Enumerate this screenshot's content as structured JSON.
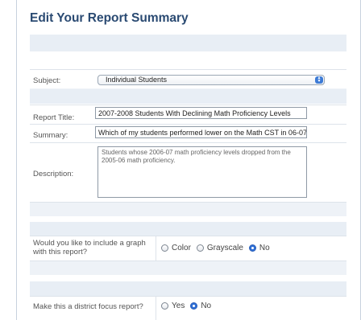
{
  "title": "Edit Your Report Summary",
  "subject": {
    "label": "Subject:",
    "value": "Individual Students"
  },
  "report_title": {
    "label": "Report Title:",
    "value": "2007-2008 Students With Declining Math Proficiency Levels"
  },
  "summary": {
    "label": "Summary:",
    "value": "Which of my students performed lower on the Math CST in 06-07"
  },
  "description": {
    "label": "Description:",
    "value": "Students whose 2006-07  math proficiency levels dropped from the 2005-06 math proficiency."
  },
  "graph": {
    "label": "Would you like to include a graph with this report?",
    "options": [
      "Color",
      "Grayscale",
      "No"
    ],
    "selected": "No"
  },
  "focus": {
    "label": "Make this a district focus report?",
    "options": [
      "Yes",
      "No"
    ],
    "selected": "No"
  }
}
